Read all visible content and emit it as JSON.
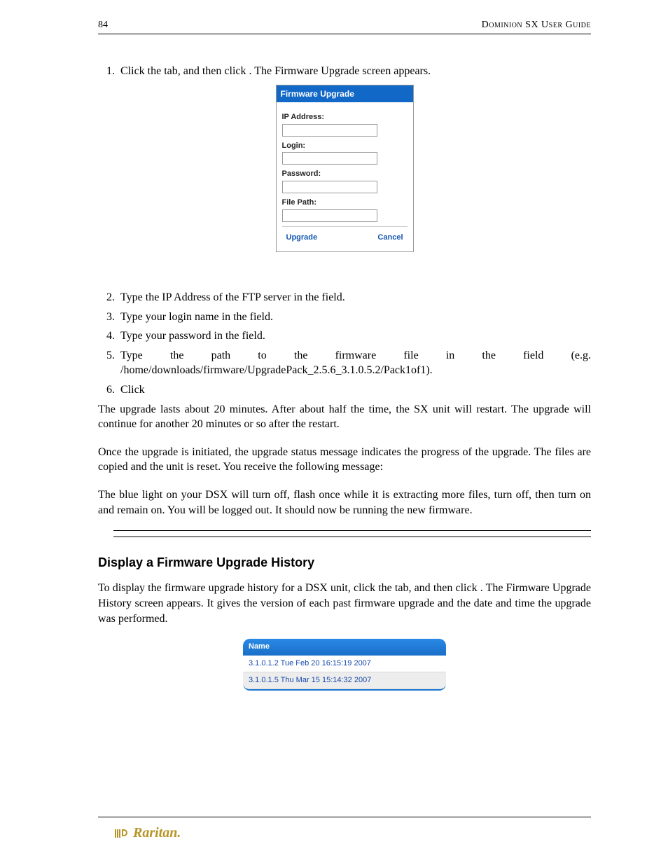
{
  "header": {
    "page_number": "84",
    "doc_title": "Dominion SX User Guide"
  },
  "steps_a": [
    "Click  the                             tab,  and  then  click                                  .  The  Firmware  Upgrade screen appears."
  ],
  "dialog": {
    "title": "Firmware Upgrade",
    "fields": {
      "ip_label": "IP Address:",
      "login_label": "Login:",
      "password_label": "Password:",
      "filepath_label": "File Path:"
    },
    "buttons": {
      "upgrade": "Upgrade",
      "cancel": "Cancel"
    }
  },
  "steps_b": [
    "Type the IP Address of the FTP server in the                         field.",
    "Type your login name in the               field.",
    "Type your password in the                     field.",
    "Type    the    path    to    the    firmware    file    in    the                                    field    (e.g. /home/downloads/firmware/UpgradePack_2.5.6_3.1.0.5.2/Pack1of1).",
    "Click"
  ],
  "paragraphs": {
    "p1": "The upgrade lasts about 20 minutes.  After about half the time, the SX unit will restart. The upgrade will continue for another 20 minutes or so after the restart.",
    "p2": "Once the upgrade is initiated, the upgrade status message indicates the progress of the upgrade. The files are copied and the unit is reset. You receive the following message:",
    "p3": "The blue light on your DSX will turn off, flash once while it is extracting more files, turn off, then turn on and remain on. You will be logged out. It should now be running the new firmware."
  },
  "section_heading": "Display a Firmware Upgrade History",
  "history_intro": "To display the firmware upgrade history for a DSX unit, click the                         tab, and then click                                            . The Firmware Upgrade History screen appears. It gives the version of each past firmware upgrade and the date and time the upgrade was performed.",
  "history_table": {
    "header": "Name",
    "rows": [
      "3.1.0.1.2 Tue Feb 20 16:15:19 2007",
      "3.1.0.1.5 Thu Mar 15 15:14:32 2007"
    ]
  },
  "logo_text": "Raritan."
}
